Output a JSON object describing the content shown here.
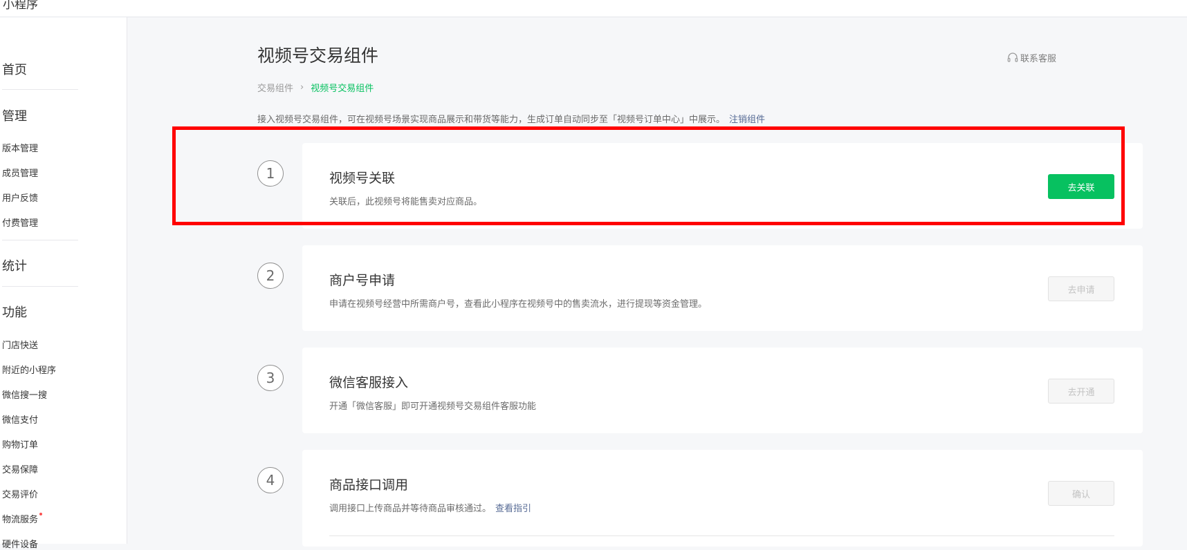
{
  "topbar": {
    "brand": "小程序"
  },
  "sidebar": {
    "home": "首页",
    "manage": {
      "label": "管理",
      "items": [
        "版本管理",
        "成员管理",
        "用户反馈",
        "付费管理"
      ]
    },
    "stats": "统计",
    "features": {
      "label": "功能",
      "items": [
        "门店快送",
        "附近的小程序",
        "微信搜一搜",
        "微信支付",
        "购物订单",
        "交易保障",
        "交易评价",
        "物流服务",
        "硬件设备"
      ]
    }
  },
  "header": {
    "title": "视频号交易组件",
    "contact": "联系客服",
    "breadcrumb": [
      "交易组件",
      "视频号交易组件"
    ],
    "intro": "接入视频号交易组件，可在视频号场景实现商品展示和带货等能力，生成订单自动同步至「视频号订单中心」中展示。",
    "intro_link": "注销组件"
  },
  "steps": [
    {
      "number": "1",
      "title": "视频号关联",
      "desc": "关联后，此视频号将能售卖对应商品。",
      "button": "去关联",
      "enabled": true
    },
    {
      "number": "2",
      "title": "商户号申请",
      "desc": "申请在视频号经营中所需商户号，查看此小程序在视频号中的售卖流水，进行提现等资金管理。",
      "button": "去申请",
      "enabled": false
    },
    {
      "number": "3",
      "title": "微信客服接入",
      "desc": "开通「微信客服」即可开通视频号交易组件客服功能",
      "button": "去开通",
      "enabled": false
    },
    {
      "number": "4",
      "title": "商品接口调用",
      "desc": "调用接口上传商品并等待商品审核通过。",
      "desc_link": "查看指引",
      "button": "确认",
      "enabled": false
    }
  ],
  "colors": {
    "primary": "#07c160",
    "link": "#576b95",
    "highlight": "#ff0000"
  }
}
